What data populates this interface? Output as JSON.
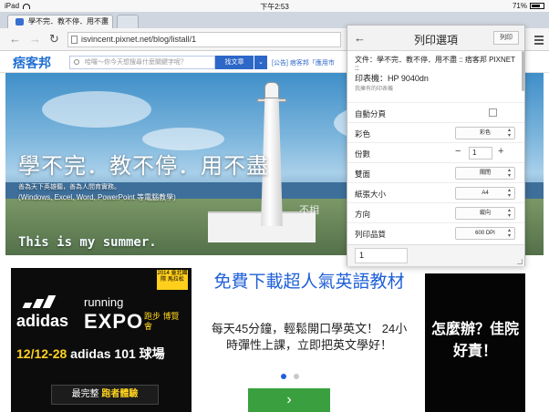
{
  "status_bar": {
    "device": "iPad",
    "time": "下午2:53",
    "battery": "71%",
    "battery_level": 0.71
  },
  "tabs": [
    {
      "title": "學不完．教不停．用不盡"
    }
  ],
  "toolbar": {
    "url": "isvincent.pixnet.net/blog/listall/1"
  },
  "site": {
    "logo": "痞客邦",
    "search_placeholder": "哈囉～你今天想搜尋什麼關鍵字呢？",
    "search_button": "找文章",
    "announcement": "[公告] 痞客邦「應用市"
  },
  "banner": {
    "title": "學不完．教不停．用不盡",
    "subtitle1": "善為天下英雄聽，善為人間育實務。",
    "subtitle2": "(Windows, Excel, Word, PowerPoint 等電腦教學)",
    "script_text": "This is my summer.",
    "sign": "不相"
  },
  "ad_left": {
    "year": "2014 臺北國際 馬拉松",
    "brand": "adidas",
    "running": "running",
    "expo": "EXPO",
    "expo_cn": "跑步 博覽會",
    "date": "12/12-28",
    "venue": "adidas 101 球場",
    "cta_prefix": "最完整",
    "cta_highlight": "跑者體驗"
  },
  "ad_center": {
    "headline": "免費下載超人氣英語教材",
    "body": "每天45分鐘，輕鬆開口學英文！ 24小時彈性上課，立即把英文學好！",
    "go_button": "›",
    "active_dot_color": "#1f60d8",
    "inactive_dot_color": "#c8c8c8"
  },
  "ad_right": {
    "text": "怎麼辦？佳院好責！"
  },
  "print_panel": {
    "title": "列印選項",
    "print_button": "列印",
    "document_name": "文件：學不完．教不停．用不盡 :: 痞客邦 PIXNET ::",
    "printer": "印表機：HP 9040dn",
    "printer_sub": "我擁有的印表機",
    "rows": {
      "duplex": {
        "label": "自動分頁"
      },
      "color": {
        "label": "彩色",
        "value": "彩色"
      },
      "copies": {
        "label": "份數",
        "value": "1"
      },
      "two_sided": {
        "label": "雙面",
        "value": "關閉"
      },
      "paper": {
        "label": "紙張大小",
        "value": "A4"
      },
      "orientation": {
        "label": "方向",
        "value": "縱向"
      },
      "quality": {
        "label": "列印品質",
        "value": "600 DPI"
      }
    },
    "page_range": "1"
  },
  "colors": {
    "accent_blue": "#2d67c8",
    "adidas_yellow": "#ffd21f",
    "green_button": "#3aa03f"
  }
}
